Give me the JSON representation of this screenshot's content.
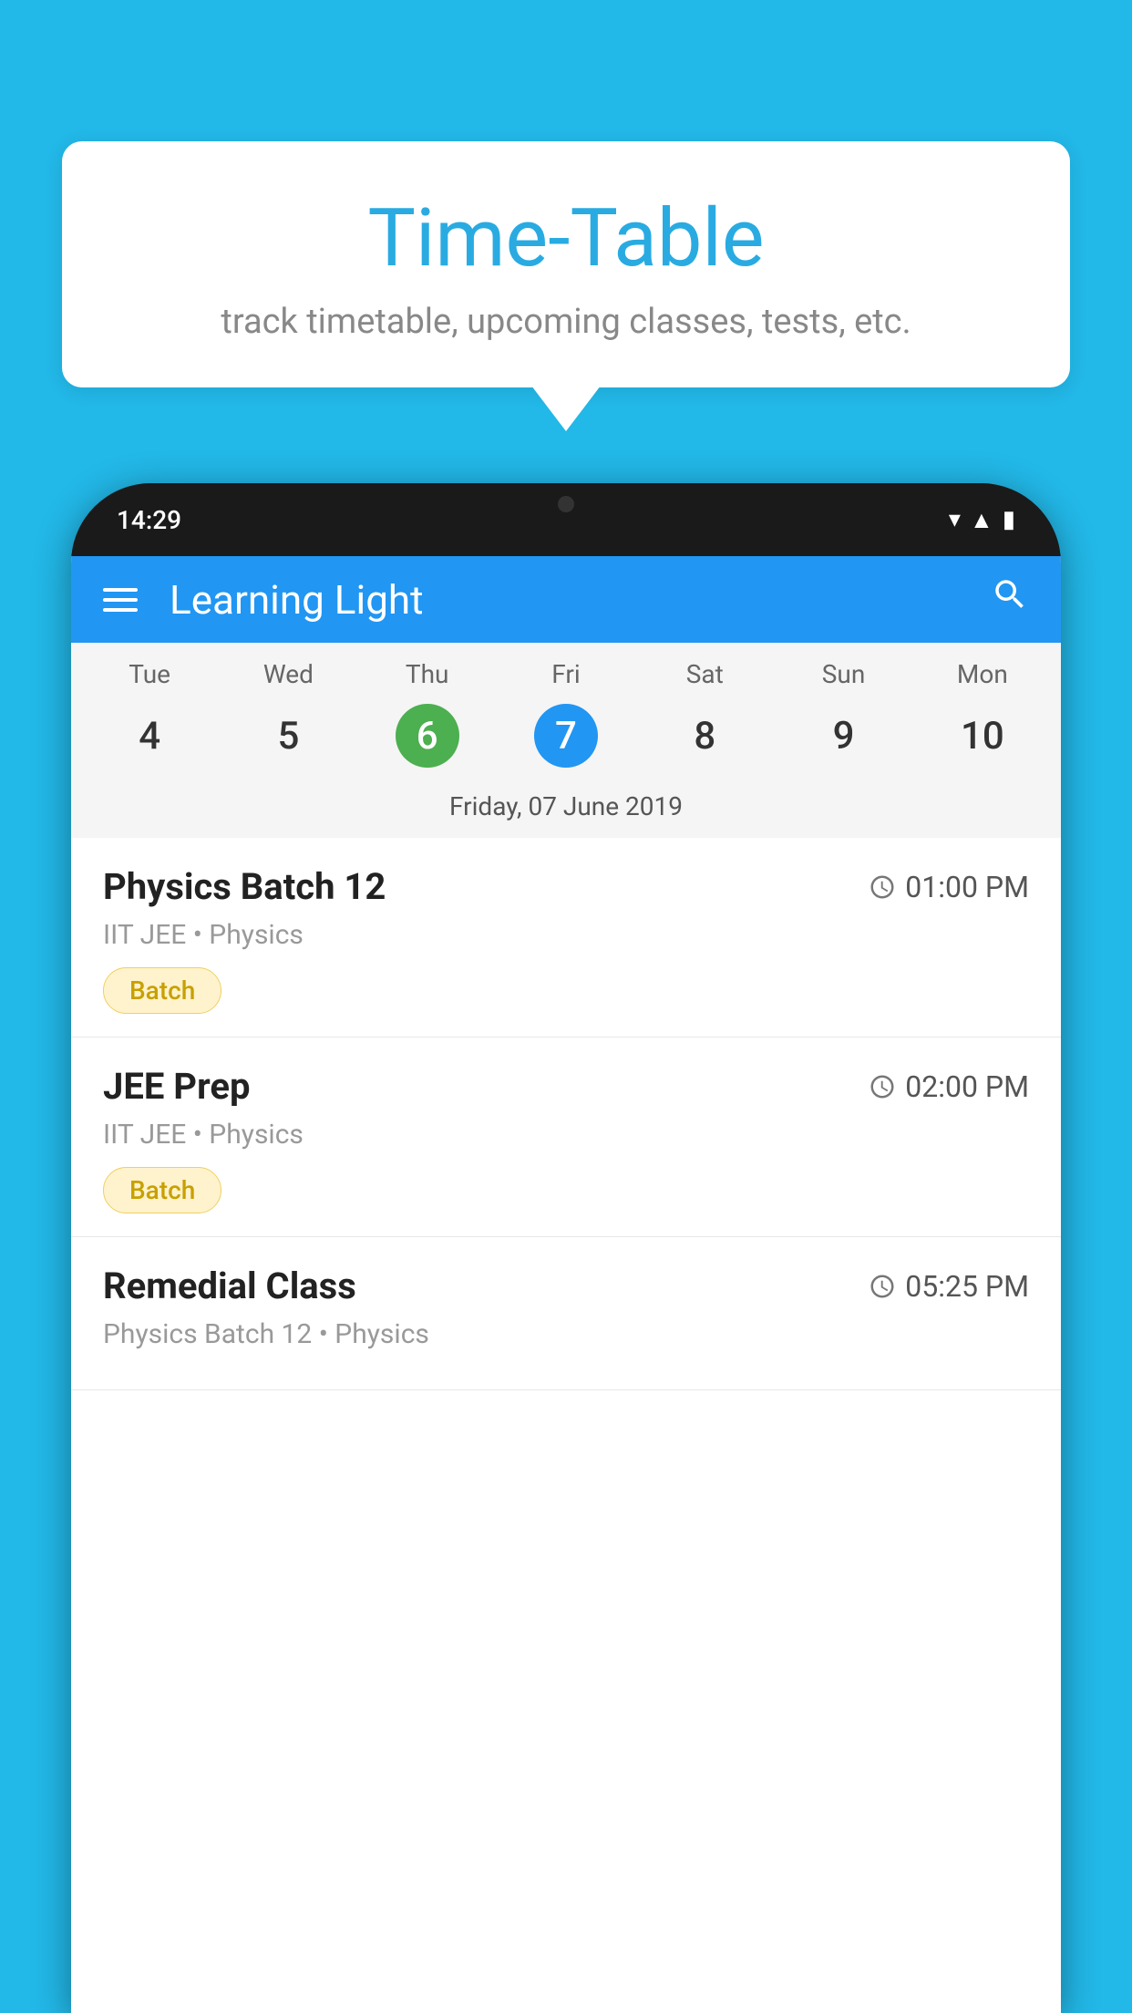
{
  "background_color": "#22b8e8",
  "bubble": {
    "title": "Time-Table",
    "subtitle": "track timetable, upcoming classes, tests, etc."
  },
  "phone": {
    "status_time": "14:29",
    "app_name": "Learning Light",
    "calendar": {
      "days_of_week": [
        "Tue",
        "Wed",
        "Thu",
        "Fri",
        "Sat",
        "Sun",
        "Mon"
      ],
      "day_numbers": [
        "4",
        "5",
        "6",
        "7",
        "8",
        "9",
        "10"
      ],
      "today_index": 2,
      "selected_index": 3,
      "selected_date_label": "Friday, 07 June 2019"
    },
    "schedule_items": [
      {
        "title": "Physics Batch 12",
        "time": "01:00 PM",
        "subtitle": "IIT JEE • Physics",
        "badge": "Batch"
      },
      {
        "title": "JEE Prep",
        "time": "02:00 PM",
        "subtitle": "IIT JEE • Physics",
        "badge": "Batch"
      },
      {
        "title": "Remedial Class",
        "time": "05:25 PM",
        "subtitle": "Physics Batch 12 • Physics",
        "badge": null
      }
    ]
  }
}
